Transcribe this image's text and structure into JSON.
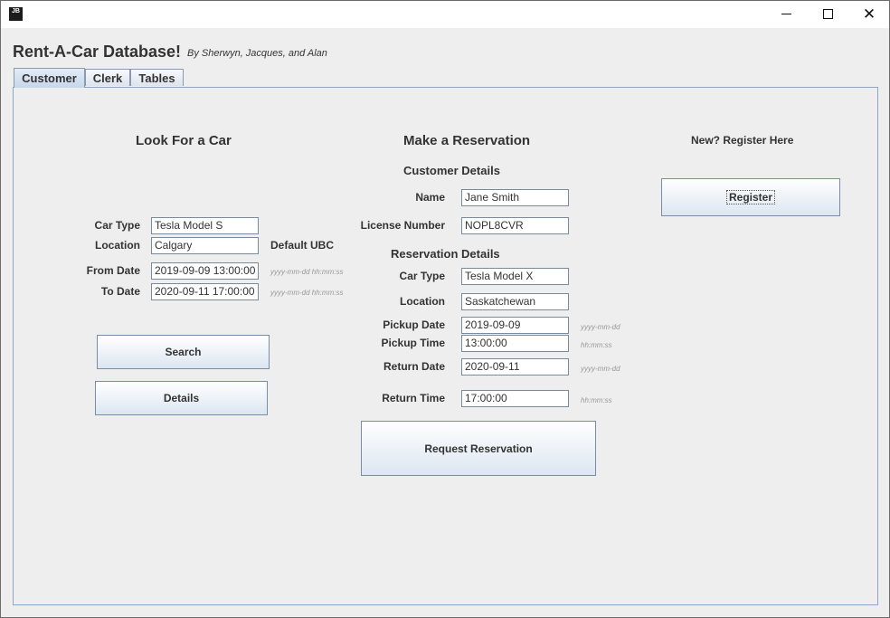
{
  "window": {
    "icon_text": "JB",
    "controls": {
      "minimize": "minimize",
      "maximize": "maximize",
      "close": "✕"
    }
  },
  "header": {
    "title": "Rent-A-Car Database!",
    "subtitle": "By Sherwyn, Jacques, and Alan"
  },
  "tabs": [
    {
      "label": "Customer",
      "active": true
    },
    {
      "label": "Clerk",
      "active": false
    },
    {
      "label": "Tables",
      "active": false
    }
  ],
  "look_for_car": {
    "heading": "Look For a Car",
    "car_type_label": "Car Type",
    "car_type_value": "Tesla Model S",
    "location_label": "Location",
    "location_value": "Calgary",
    "default_note": "Default UBC",
    "from_date_label": "From Date",
    "from_date_value": "2019-09-09 13:00:00",
    "from_date_hint": "yyyy-mm-dd hh:mm:ss",
    "to_date_label": "To Date",
    "to_date_value": "2020-09-11 17:00:00",
    "to_date_hint": "yyyy-mm-dd hh:mm:ss",
    "search_button": "Search",
    "details_button": "Details"
  },
  "reservation": {
    "heading": "Make a Reservation",
    "customer_details_heading": "Customer Details",
    "name_label": "Name",
    "name_value": "Jane Smith",
    "license_label": "License Number",
    "license_value": "NOPL8CVR",
    "reservation_details_heading": "Reservation Details",
    "car_type_label": "Car Type",
    "car_type_value": "Tesla Model X",
    "location_label": "Location",
    "location_value": "Saskatchewan",
    "pickup_date_label": "Pickup Date",
    "pickup_date_value": "2019-09-09",
    "pickup_date_hint": "yyyy-mm-dd",
    "pickup_time_label": "Pickup Time",
    "pickup_time_value": "13:00:00",
    "pickup_time_hint": "hh:mm:ss",
    "return_date_label": "Return Date",
    "return_date_value": "2020-09-11",
    "return_date_hint": "yyyy-mm-dd",
    "return_time_label": "Return Time",
    "return_time_value": "17:00:00",
    "return_time_hint": "hh:mm:ss",
    "request_button": "Request Reservation"
  },
  "register": {
    "heading": "New? Register Here",
    "button": "Register"
  }
}
